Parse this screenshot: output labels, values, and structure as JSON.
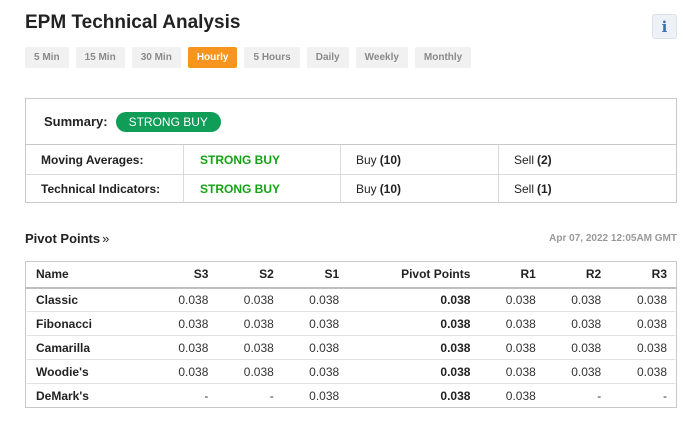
{
  "header": {
    "title": "EPM Technical Analysis",
    "info_icon": "i"
  },
  "tabs": [
    {
      "label": "5 Min",
      "active": false
    },
    {
      "label": "15 Min",
      "active": false
    },
    {
      "label": "30 Min",
      "active": false
    },
    {
      "label": "Hourly",
      "active": true
    },
    {
      "label": "5 Hours",
      "active": false
    },
    {
      "label": "Daily",
      "active": false
    },
    {
      "label": "Weekly",
      "active": false
    },
    {
      "label": "Monthly",
      "active": false
    }
  ],
  "summary": {
    "label": "Summary:",
    "verdict": "STRONG BUY",
    "rows": [
      {
        "name": "Moving Averages:",
        "verdict": "STRONG BUY",
        "buy_label": "Buy",
        "buy_count": "(10)",
        "sell_label": "Sell",
        "sell_count": "(2)"
      },
      {
        "name": "Technical Indicators:",
        "verdict": "STRONG BUY",
        "buy_label": "Buy",
        "buy_count": "(10)",
        "sell_label": "Sell",
        "sell_count": "(1)"
      }
    ]
  },
  "pivot": {
    "title": "Pivot Points",
    "arrow": "»",
    "timestamp": "Apr 07, 2022 12:05AM GMT",
    "columns": [
      "Name",
      "S3",
      "S2",
      "S1",
      "Pivot Points",
      "R1",
      "R2",
      "R3"
    ],
    "rows": [
      [
        "Classic",
        "0.038",
        "0.038",
        "0.038",
        "0.038",
        "0.038",
        "0.038",
        "0.038"
      ],
      [
        "Fibonacci",
        "0.038",
        "0.038",
        "0.038",
        "0.038",
        "0.038",
        "0.038",
        "0.038"
      ],
      [
        "Camarilla",
        "0.038",
        "0.038",
        "0.038",
        "0.038",
        "0.038",
        "0.038",
        "0.038"
      ],
      [
        "Woodie's",
        "0.038",
        "0.038",
        "0.038",
        "0.038",
        "0.038",
        "0.038",
        "0.038"
      ],
      [
        "DeMark's",
        "-",
        "-",
        "0.038",
        "0.038",
        "0.038",
        "-",
        "-"
      ]
    ]
  },
  "colors": {
    "accent": "#f7941e",
    "strong_buy": "#0f9d58",
    "buy_text": "#15a215"
  }
}
